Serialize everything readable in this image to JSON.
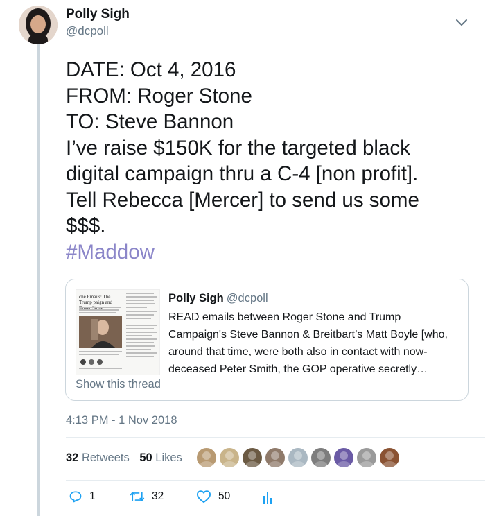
{
  "author": {
    "name": "Polly Sigh",
    "handle": "@dcpoll"
  },
  "tweet": {
    "lines": [
      "DATE: Oct 4, 2016",
      "FROM: Roger Stone",
      "TO: Steve Bannon",
      "I’ve raise $150K for the targeted black",
      "digital campaign thru a C-4 [non profit].",
      "Tell Rebecca [Mercer] to send us some",
      "$$$."
    ],
    "hashtag": "#Maddow"
  },
  "quoted": {
    "name": "Polly Sigh",
    "handle": "@dcpoll",
    "lines": [
      "READ emails between Roger Stone and Trump",
      "Campaign's Steve Bannon & Breitbart’s Matt Boyle [who,",
      "around that time, were both also in contact with now-",
      "deceased Peter Smith, the GOP operative secretly…"
    ],
    "show_thread": "Show this thread",
    "thumbnail": {
      "headline": "che Emails: The Trump paign and Roger Stone"
    }
  },
  "timestamp": "4:13 PM - 1 Nov 2018",
  "stats": {
    "retweets_count": "32",
    "retweets_label": "Retweets",
    "likes_count": "50",
    "likes_label": "Likes"
  },
  "likers": [
    {
      "color": "#b89a72",
      "icon": "pug-avatar"
    },
    {
      "color": "#c9b48a",
      "icon": "flower-avatar"
    },
    {
      "color": "#6b5a43",
      "icon": "crowd-avatar"
    },
    {
      "color": "#8f7a6a",
      "icon": "person-avatar"
    },
    {
      "color": "#aab8c2",
      "icon": "default-avatar"
    },
    {
      "color": "#7d7d7d",
      "icon": "ornament-avatar"
    },
    {
      "color": "#6a5aa5",
      "icon": "fleur-de-lis-avatar"
    },
    {
      "color": "#9a9a9a",
      "icon": "eagle-avatar"
    },
    {
      "color": "#8a5232",
      "icon": "pet-avatar"
    }
  ],
  "actions": {
    "replies": "1",
    "retweets": "32",
    "likes": "50"
  },
  "colors": {
    "link": "#1da1f2",
    "hashtag": "#8b86c9",
    "muted": "#657786",
    "thread_line": "#ccd6dd"
  }
}
